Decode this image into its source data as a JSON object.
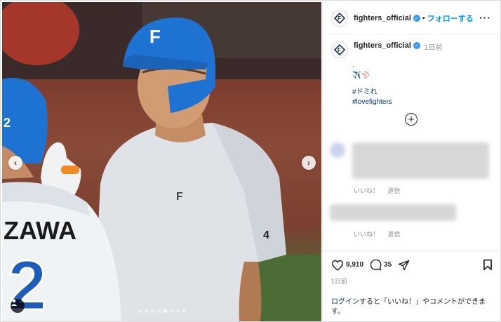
{
  "post": {
    "photo": {
      "jersey_name": "ZAWA",
      "jersey_number": "2",
      "sleeve_number": "4",
      "helmet_letter": "F",
      "carousel_count": 8,
      "carousel_active_index": 4
    },
    "header": {
      "username": "fighters_official",
      "separator": "•",
      "follow_label": "フォローする",
      "more_label": "···"
    },
    "caption": {
      "username": "fighters_official",
      "time_ago": "1日前",
      "dot_line": ".",
      "emoji_line": "✈️⚾",
      "hashtags": [
        "#ドミれ",
        "#lovefighters"
      ]
    },
    "comments": {
      "like_label": "いいね！",
      "reply_label": "返信"
    },
    "actions": {
      "likes": "9,910",
      "comments": "35",
      "date": "1日前",
      "login_link": "ログイン",
      "login_text": "すると「いいね！」やコメントができます。"
    },
    "colors": {
      "accent": "#0095f6",
      "hashtag": "#00376b",
      "helmet": "#1e73d2"
    }
  }
}
